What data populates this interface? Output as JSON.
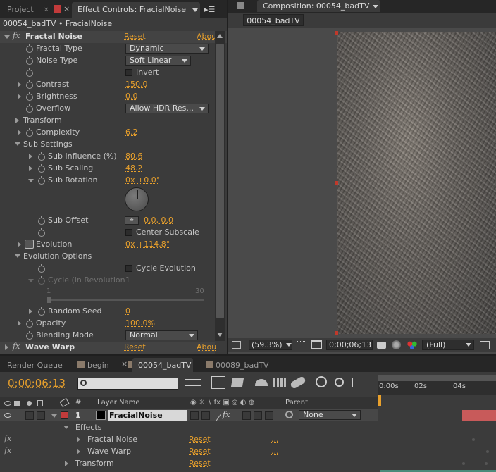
{
  "left_panel": {
    "tabs": {
      "project": "Project",
      "effect_controls": "Effect Controls: FracialNoise"
    },
    "breadcrumb": "00054_badTV • FracialNoise",
    "fractal": {
      "effect_name": "Fractal Noise",
      "reset": "Reset",
      "about": "Abou",
      "fractal_type_label": "Fractal Type",
      "fractal_type_value": "Dynamic",
      "noise_type_label": "Noise Type",
      "noise_type_value": "Soft Linear",
      "invert_label": "Invert",
      "contrast_label": "Contrast",
      "contrast_value": "150.0",
      "brightness_label": "Brightness",
      "brightness_value": "0.0",
      "overflow_label": "Overflow",
      "overflow_value": "Allow HDR Res...",
      "transform_label": "Transform",
      "complexity_label": "Complexity",
      "complexity_value": "6.2",
      "sub_settings_label": "Sub Settings",
      "sub_influence_label": "Sub Influence (%)",
      "sub_influence_value": "80.6",
      "sub_scaling_label": "Sub Scaling",
      "sub_scaling_value": "48.2",
      "sub_rotation_label": "Sub Rotation",
      "sub_rotation_value_a": "0x",
      "sub_rotation_value_b": "+0.0°",
      "sub_offset_label": "Sub Offset",
      "sub_offset_value": "0.0, 0.0",
      "center_subscale_label": "Center Subscale",
      "evolution_label": "Evolution",
      "evolution_value_a": "0x",
      "evolution_value_b": "+114.8°",
      "evolution_options_label": "Evolution Options",
      "cycle_evolution_label": "Cycle Evolution",
      "cycle_in_revolution_label": "Cycle (in Revolution",
      "cycle_in_revolution_value": "1",
      "slider_min": "1",
      "slider_max": "30",
      "random_seed_label": "Random Seed",
      "random_seed_value": "0",
      "opacity_label": "Opacity",
      "opacity_value": "100.0%",
      "blending_mode_label": "Blending Mode",
      "blending_mode_value": "Normal"
    },
    "wave": {
      "effect_name": "Wave Warp",
      "reset": "Reset",
      "about": "Abou"
    }
  },
  "comp_panel": {
    "tab": "Composition: 00054_badTV",
    "comp_button": "00054_badTV",
    "zoom": "(59.3%)",
    "timecode": "0;00;06;13",
    "resolution": "(Full)"
  },
  "timeline": {
    "tabs": [
      "Render Queue",
      "begin",
      "00054_badTV",
      "00089_badTV"
    ],
    "current_time": "0;00;06;13",
    "ruler": [
      "0:00s",
      "02s",
      "04s"
    ],
    "headers": {
      "num": "#",
      "layer_name": "Layer Name",
      "parent": "Parent"
    },
    "layer": {
      "num": "1",
      "name": "FracialNoise",
      "parent": "None"
    },
    "effects_label": "Effects",
    "effect_rows": [
      {
        "name": "Fractal Noise",
        "reset": "Reset",
        "dots": "..."
      },
      {
        "name": "Wave Warp",
        "reset": "Reset",
        "dots": "..."
      }
    ],
    "transform": {
      "name": "Transform",
      "reset": "Reset"
    }
  },
  "colors": {
    "accent": "#e8a02c",
    "layer_label": "#c23b3b",
    "bar": "#c85a5a"
  }
}
